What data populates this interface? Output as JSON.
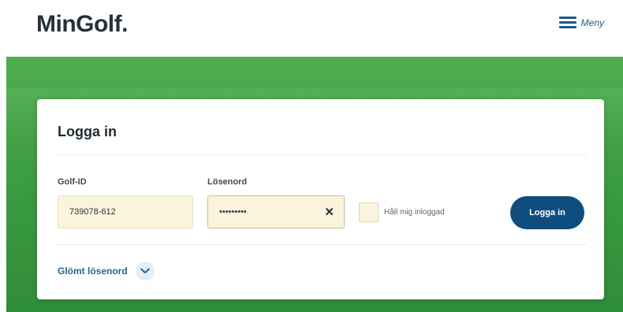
{
  "header": {
    "logo": "MinGolf.",
    "menu_label": "Meny",
    "menu_icon": "hamburger-menu-icon"
  },
  "login": {
    "title": "Logga in",
    "golf_id": {
      "label": "Golf-ID",
      "value": "739078-612"
    },
    "password": {
      "label": "Lösenord",
      "value": "•••••••••",
      "clear_icon": "close-icon"
    },
    "remember": {
      "label": "Håll mig inloggad",
      "checked": false
    },
    "submit_label": "Logga in",
    "forgot_label": "Glömt lösenord",
    "forgot_icon": "chevron-down-icon"
  },
  "colors": {
    "brand_green": "#3a9a40",
    "button_blue": "#0f4d7f",
    "field_bg": "#fbf4dc",
    "link_blue": "#1d6a93"
  }
}
